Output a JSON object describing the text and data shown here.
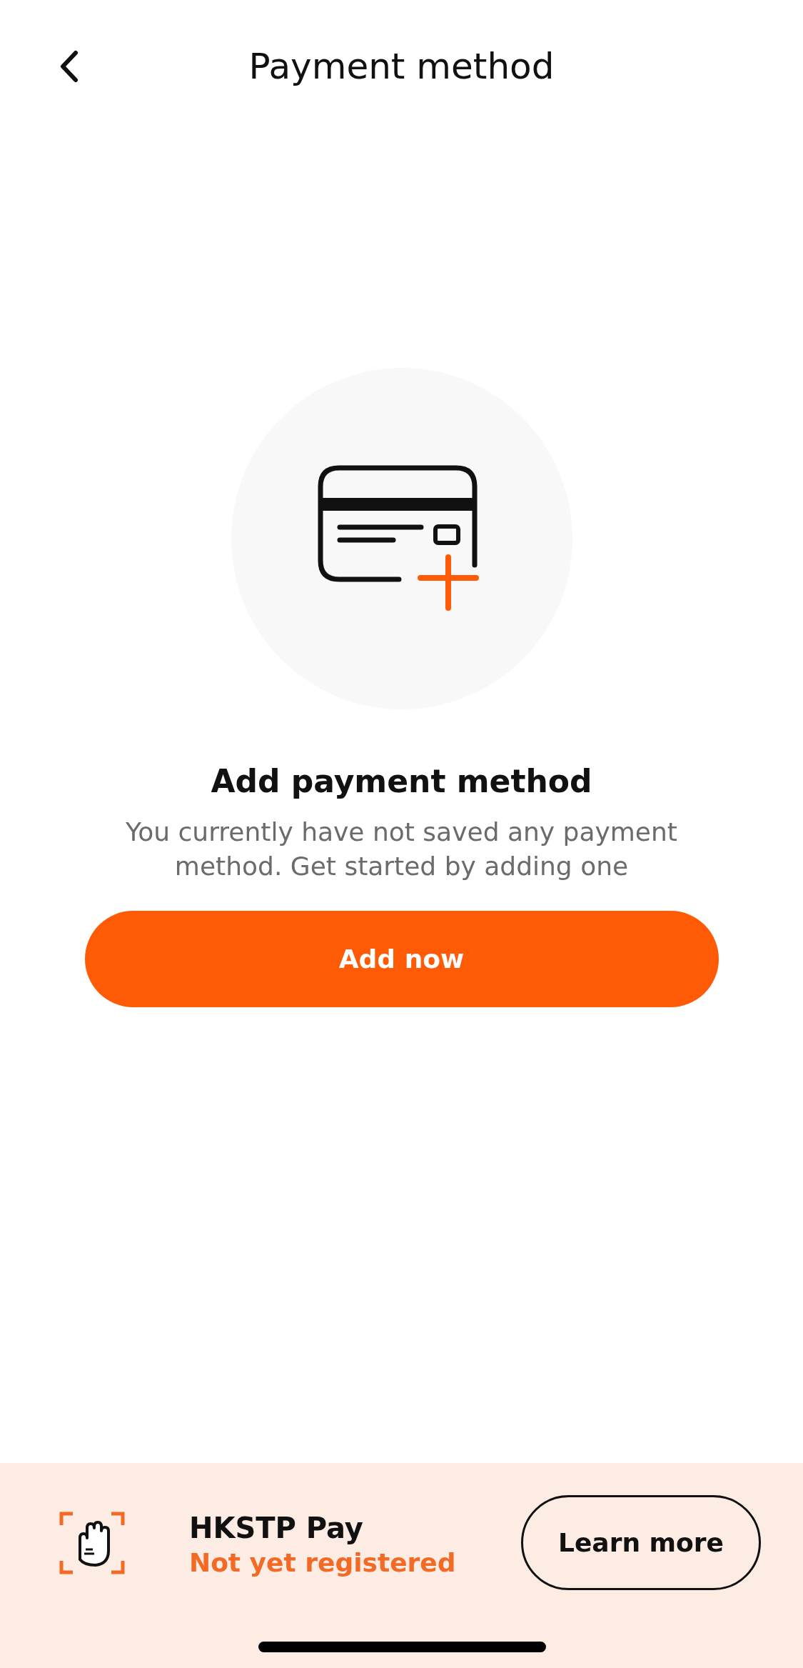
{
  "header": {
    "title": "Payment method"
  },
  "empty_state": {
    "title": "Add payment method",
    "description": "You currently have not saved any payment method. Get started by adding one",
    "button": "Add now"
  },
  "banner": {
    "title": "HKSTP Pay",
    "status": "Not yet registered",
    "button": "Learn more"
  }
}
